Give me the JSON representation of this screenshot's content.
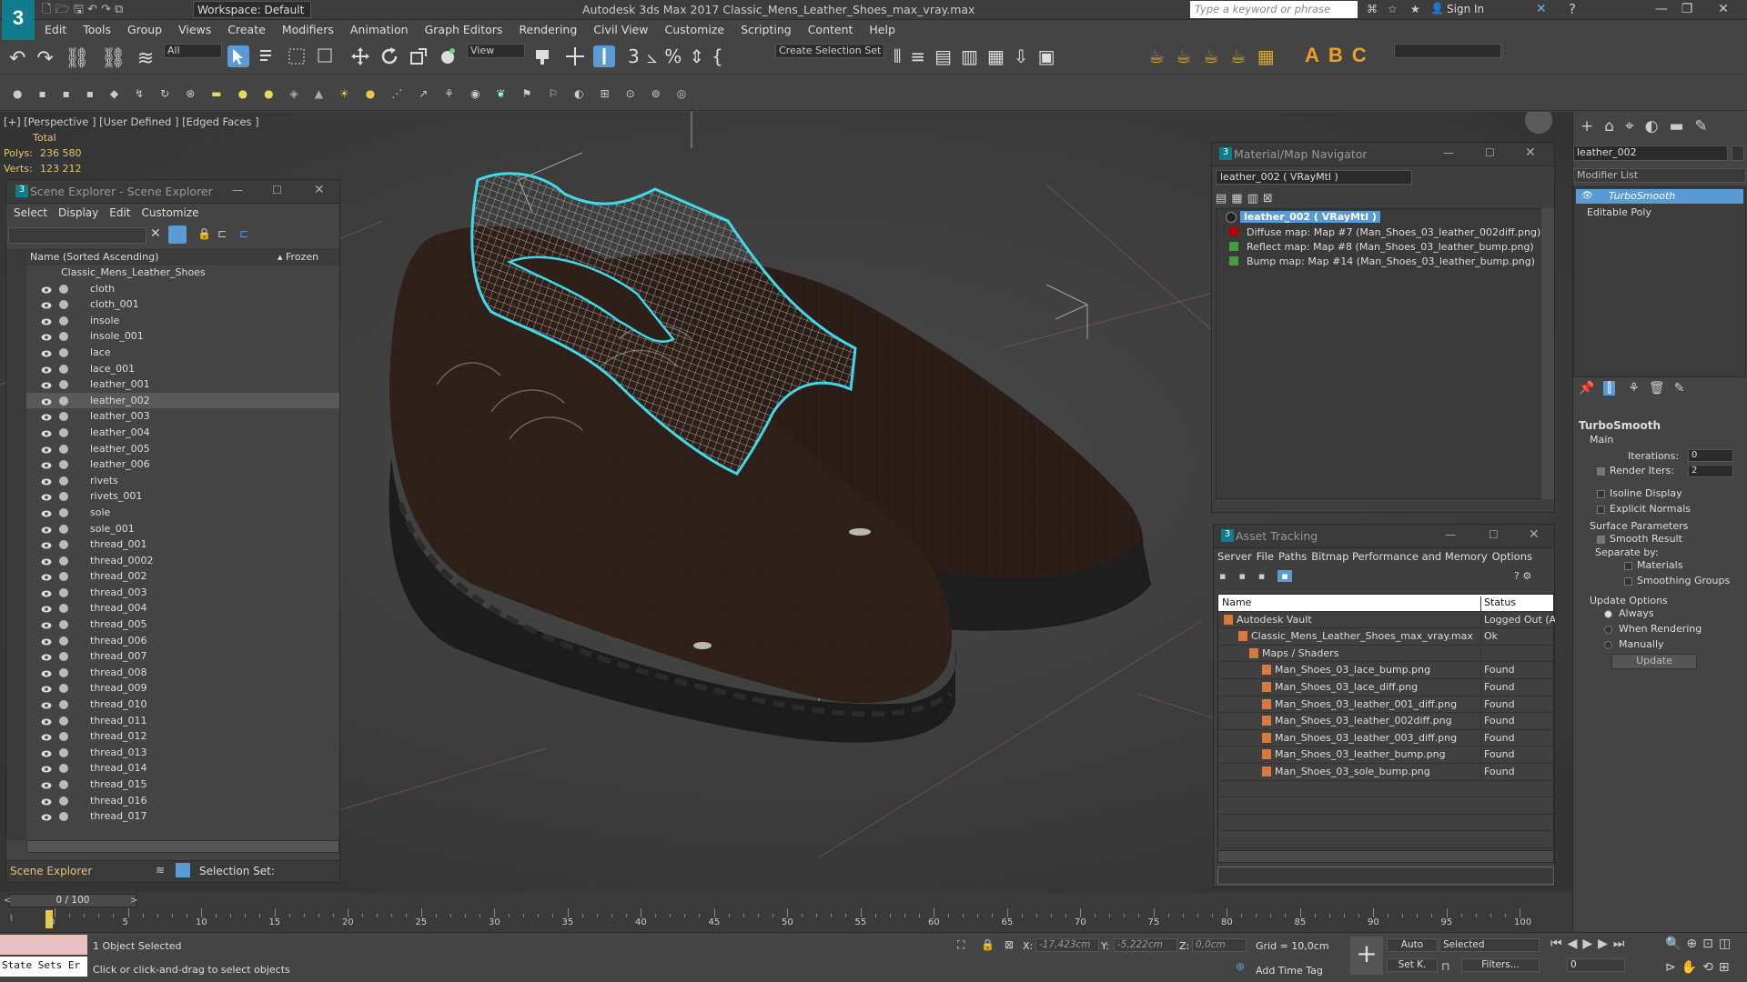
{
  "titlebar": {
    "workspace": "Workspace: Default",
    "app_title": "Autodesk 3ds Max 2017    Classic_Mens_Leather_Shoes_max_vray.max",
    "search_placeholder": "Type a keyword or phrase",
    "sign_in": "Sign In"
  },
  "menu": [
    "Edit",
    "Tools",
    "Group",
    "Views",
    "Create",
    "Modifiers",
    "Animation",
    "Graph Editors",
    "Rendering",
    "Civil View",
    "Customize",
    "Scripting",
    "Content",
    "Help"
  ],
  "toolbar": {
    "selection_filter": "All",
    "reference_coord": "View",
    "selection_set": "Create Selection Set"
  },
  "viewport": {
    "label": "[+] [Perspective ] [User Defined ] [Edged Faces ]",
    "total_label": "Total",
    "polys_label": "Polys:",
    "polys_value": "236 580",
    "verts_label": "Verts:",
    "verts_value": "123 212"
  },
  "scene_explorer": {
    "title": "Scene Explorer - Scene Explorer",
    "menu": [
      "Select",
      "Display",
      "Edit",
      "Customize"
    ],
    "col_name": "Name (Sorted Ascending)",
    "col_frozen": "▴ Frozen",
    "root": "Classic_Mens_Leather_Shoes",
    "items": [
      "cloth",
      "cloth_001",
      "insole",
      "insole_001",
      "lace",
      "lace_001",
      "leather_001",
      "leather_002",
      "leather_003",
      "leather_004",
      "leather_005",
      "leather_006",
      "rivets",
      "rivets_001",
      "sole",
      "sole_001",
      "thread_001",
      "thread_0002",
      "thread_002",
      "thread_003",
      "thread_004",
      "thread_005",
      "thread_006",
      "thread_007",
      "thread_008",
      "thread_009",
      "thread_010",
      "thread_011",
      "thread_012",
      "thread_013",
      "thread_014",
      "thread_015",
      "thread_016",
      "thread_017"
    ],
    "selected": "leather_002",
    "footer_left": "Scene Explorer",
    "footer_right": "Selection Set:"
  },
  "material_navigator": {
    "title": "Material/Map Navigator",
    "name_field": "leather_002  ( VRayMtl )",
    "root": "leather_002  ( VRayMtl )",
    "maps": [
      "Diffuse map: Map #7 (Man_Shoes_03_leather_002diff.png)",
      "Reflect map: Map #8 (Man_Shoes_03_leather_bump.png)",
      "Bump map: Map #14 (Man_Shoes_03_leather_bump.png)"
    ]
  },
  "asset_tracking": {
    "title": "Asset Tracking",
    "menu": [
      "Server",
      "File",
      "Paths",
      "Bitmap Performance and Memory",
      "Options"
    ],
    "col_name": "Name",
    "col_status": "Status",
    "rows": [
      {
        "name": "Autodesk Vault",
        "status": "Logged Out (A"
      },
      {
        "name": "Classic_Mens_Leather_Shoes_max_vray.max",
        "status": "Ok"
      },
      {
        "name": "Maps / Shaders",
        "status": ""
      },
      {
        "name": "Man_Shoes_03_lace_bump.png",
        "status": "Found"
      },
      {
        "name": "Man_Shoes_03_lace_diff.png",
        "status": "Found"
      },
      {
        "name": "Man_Shoes_03_leather_001_diff.png",
        "status": "Found"
      },
      {
        "name": "Man_Shoes_03_leather_002diff.png",
        "status": "Found"
      },
      {
        "name": "Man_Shoes_03_leather_003_diff.png",
        "status": "Found"
      },
      {
        "name": "Man_Shoes_03_leather_bump.png",
        "status": "Found"
      },
      {
        "name": "Man_Shoes_03_sole_bump.png",
        "status": "Found"
      }
    ]
  },
  "command_panel": {
    "object_name": "leather_002",
    "modifier_list": "Modifier List",
    "stack": [
      "TurboSmooth",
      "Editable Poly"
    ],
    "rollout_title": "TurboSmooth",
    "main": "Main",
    "iterations_label": "Iterations:",
    "iterations_value": "0",
    "render_iters_label": "Render Iters:",
    "render_iters_value": "2",
    "isoline": "Isoline Display",
    "explicit": "Explicit Normals",
    "surface_params": "Surface Parameters",
    "smooth_result": "Smooth Result",
    "separate_by": "Separate by:",
    "materials": "Materials",
    "smoothing_groups": "Smoothing Groups",
    "update_options": "Update Options",
    "always": "Always",
    "when_rendering": "When Rendering",
    "manually": "Manually",
    "update_btn": "Update"
  },
  "timeline": {
    "frame": "0 / 100",
    "ticks": [
      "0",
      "5",
      "10",
      "15",
      "20",
      "25",
      "30",
      "35",
      "40",
      "45",
      "50",
      "55",
      "60",
      "65",
      "70",
      "75",
      "80",
      "85",
      "90",
      "95",
      "100"
    ]
  },
  "status": {
    "state_sets": "State Sets Er",
    "objects": "1 Object Selected",
    "hint": "Click or click-and-drag to select objects",
    "x_label": "X:",
    "x_value": "-17,423cm",
    "y_label": "Y:",
    "y_value": "-5,222cm",
    "z_label": "Z:",
    "z_value": "0,0cm",
    "grid": "Grid = 10,0cm",
    "add_time_tag": "Add Time Tag",
    "auto": "Auto",
    "selected": "Selected",
    "setk": "Set K.",
    "filters": "Filters...",
    "frame_spin": "0"
  },
  "colors": {
    "accent": "#5b9bd5",
    "selection_outline": "#3fd9e8",
    "stats": "#e2c76f"
  }
}
